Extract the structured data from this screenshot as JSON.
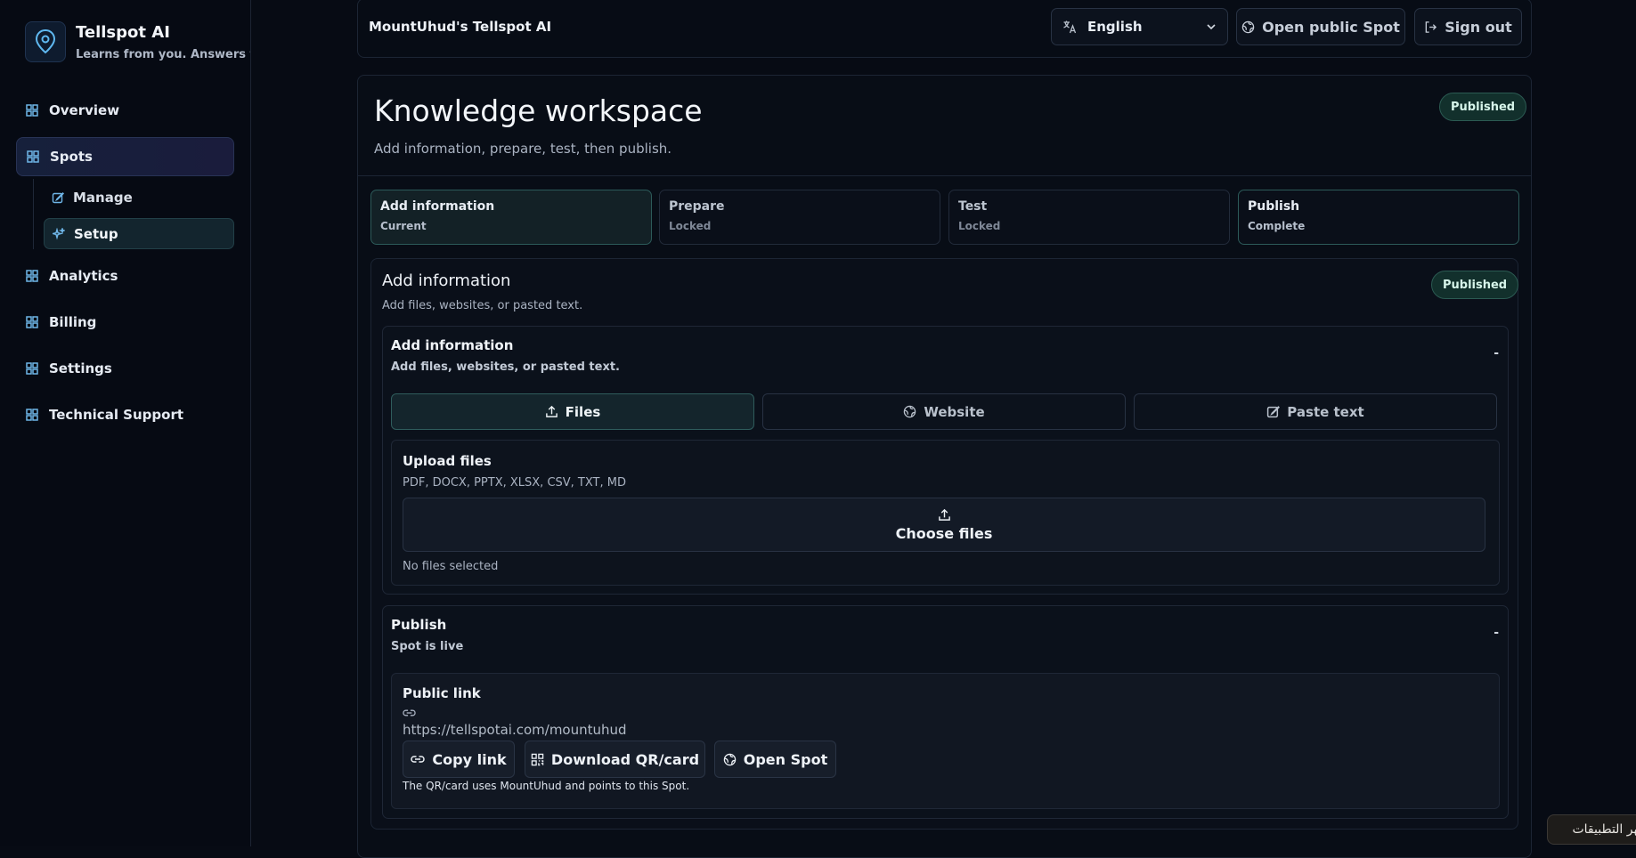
{
  "brand": {
    "title": "Tellspot AI",
    "tagline": "Learns from you. Answers for you."
  },
  "sidebar": {
    "items": [
      {
        "label": "Overview"
      },
      {
        "label": "Spots"
      },
      {
        "label": "Analytics"
      },
      {
        "label": "Billing"
      },
      {
        "label": "Settings"
      },
      {
        "label": "Technical Support"
      }
    ],
    "sub_items": [
      {
        "label": "Manage"
      },
      {
        "label": "Setup"
      }
    ]
  },
  "header": {
    "title": "MountUhud's Tellspot AI",
    "language": "English",
    "open_public_spot": "Open public Spot",
    "sign_out": "Sign out"
  },
  "workspace": {
    "title": "Knowledge workspace",
    "subtitle": "Add information, prepare, test, then publish.",
    "status": "Published",
    "steps": [
      {
        "name": "Add information",
        "state": "Current"
      },
      {
        "name": "Prepare",
        "state": "Locked"
      },
      {
        "name": "Test",
        "state": "Locked"
      },
      {
        "name": "Publish",
        "state": "Complete"
      }
    ]
  },
  "add_info_section": {
    "title": "Add information",
    "subtitle": "Add files, websites, or pasted text.",
    "status": "Published",
    "panel": {
      "title": "Add information",
      "subtitle": "Add files, websites, or pasted text.",
      "collapse": "-",
      "tabs": [
        {
          "label": "Files"
        },
        {
          "label": "Website"
        },
        {
          "label": "Paste text"
        }
      ],
      "upload": {
        "title": "Upload files",
        "formats": "PDF, DOCX, PPTX, XLSX, CSV, TXT, MD",
        "choose_label": "Choose files",
        "status": "No files selected"
      }
    },
    "publish_panel": {
      "title": "Publish",
      "subtitle": "Spot is live",
      "collapse": "-",
      "public_link": {
        "title": "Public link",
        "url": "https://tellspotai.com/mountuhud",
        "copy_label": "Copy link",
        "download_label": "Download QR/card",
        "open_label": "Open Spot",
        "note": "The QR/card uses MountUhud and points to this Spot."
      }
    }
  },
  "toast": {
    "label": "أظهر التطبيقات"
  },
  "colors": {
    "accent": "#5fb8f0",
    "teal_border": "#2c5a59",
    "background": "#070b14"
  }
}
